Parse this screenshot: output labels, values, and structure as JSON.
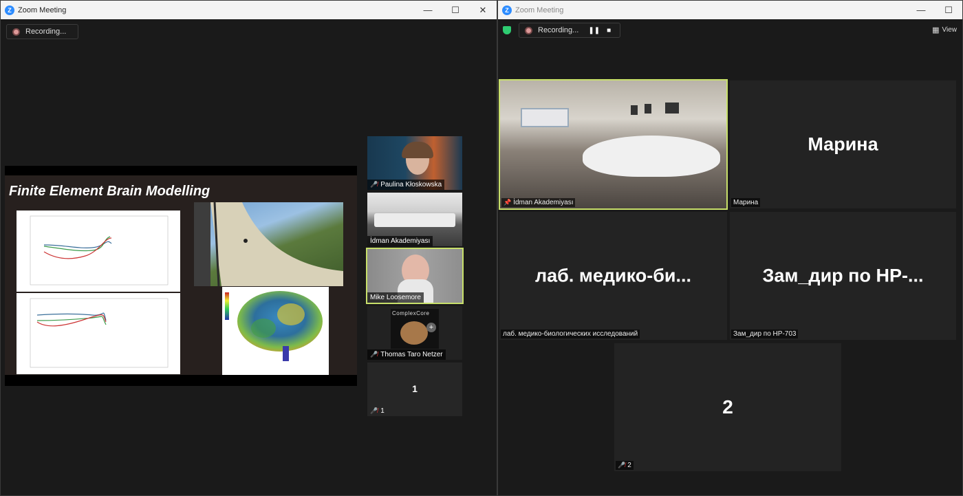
{
  "left_window": {
    "title": "Zoom Meeting",
    "controls": {
      "minimize": "—",
      "maximize": "☐",
      "close": "✕"
    },
    "recording_label": "Recording...",
    "slide": {
      "title": "Finite Element Brain Modelling"
    },
    "participants": [
      {
        "name": "Paulina Kłoskowska",
        "muted": true
      },
      {
        "name": "İdman Akademiyası",
        "muted": false
      },
      {
        "name": "Mike Loosemore",
        "muted": false
      },
      {
        "name": "Thomas Taro Netzer",
        "muted": true
      },
      {
        "name": "1",
        "display": "1",
        "muted": true
      }
    ],
    "complexcore_logo": "ComplexCore"
  },
  "right_window": {
    "title": "Zoom Meeting",
    "controls": {
      "minimize": "—",
      "maximize": "☐"
    },
    "recording_label": "Recording...",
    "view_label": "View",
    "tiles": [
      {
        "name": "İdman Akademiyası",
        "big": ""
      },
      {
        "name": "Марина",
        "big": "Марина"
      },
      {
        "name": "лаб. медико-биологических исследований",
        "big": "лаб. медико-би..."
      },
      {
        "name": "Зам_дир по НР-703",
        "big": "Зам_дир по НР-..."
      },
      {
        "name": "2",
        "big": "2",
        "muted": true
      }
    ]
  },
  "colors": {
    "active_speaker": "#c8e06a",
    "zoom_blue": "#2d8cff",
    "muted_red": "#e33333"
  }
}
